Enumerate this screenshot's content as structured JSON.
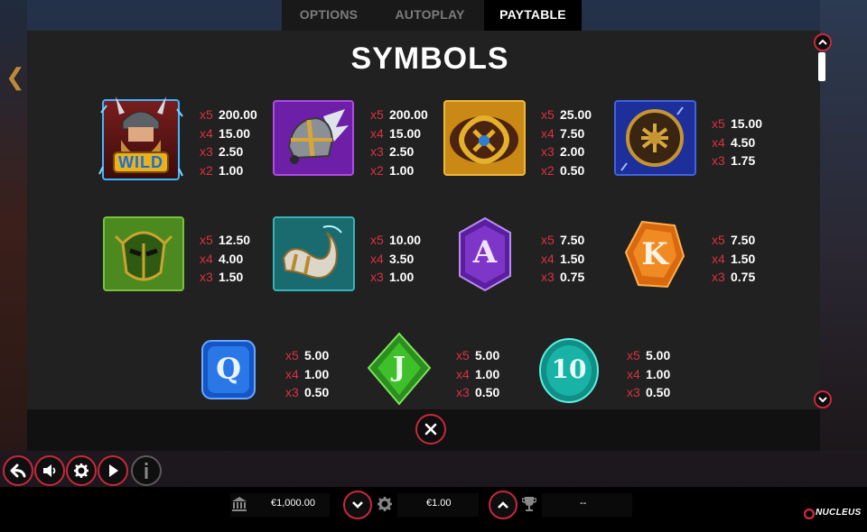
{
  "tabs": [
    {
      "label": "OPTIONS"
    },
    {
      "label": "AUTOPLAY"
    },
    {
      "label": "PAYTABLE"
    }
  ],
  "active_tab": "PAYTABLE",
  "title": "SYMBOLS",
  "symbols": [
    {
      "icon": "viking-wild-icon",
      "badge": "WILD",
      "pays": [
        {
          "mul": "x5",
          "val": "200.00"
        },
        {
          "mul": "x4",
          "val": "15.00"
        },
        {
          "mul": "x3",
          "val": "2.50"
        },
        {
          "mul": "x2",
          "val": "1.00"
        }
      ]
    },
    {
      "icon": "winged-helmet-icon",
      "pays": [
        {
          "mul": "x5",
          "val": "200.00"
        },
        {
          "mul": "x4",
          "val": "15.00"
        },
        {
          "mul": "x3",
          "val": "2.50"
        },
        {
          "mul": "x2",
          "val": "1.00"
        }
      ]
    },
    {
      "icon": "golden-knot-shield-icon",
      "pays": [
        {
          "mul": "x5",
          "val": "25.00"
        },
        {
          "mul": "x4",
          "val": "7.50"
        },
        {
          "mul": "x3",
          "val": "2.00"
        },
        {
          "mul": "x2",
          "val": "0.50"
        }
      ]
    },
    {
      "icon": "round-shield-icon",
      "pays": [
        {
          "mul": "x5",
          "val": "15.00"
        },
        {
          "mul": "x4",
          "val": "4.50"
        },
        {
          "mul": "x3",
          "val": "1.75"
        }
      ]
    },
    {
      "icon": "green-mask-icon",
      "pays": [
        {
          "mul": "x5",
          "val": "12.50"
        },
        {
          "mul": "x4",
          "val": "4.00"
        },
        {
          "mul": "x3",
          "val": "1.50"
        }
      ]
    },
    {
      "icon": "drinking-horn-icon",
      "pays": [
        {
          "mul": "x5",
          "val": "10.00"
        },
        {
          "mul": "x4",
          "val": "3.50"
        },
        {
          "mul": "x3",
          "val": "1.00"
        }
      ]
    },
    {
      "icon": "rune-a-icon",
      "glyph": "A",
      "pays": [
        {
          "mul": "x5",
          "val": "7.50"
        },
        {
          "mul": "x4",
          "val": "1.50"
        },
        {
          "mul": "x3",
          "val": "0.75"
        }
      ]
    },
    {
      "icon": "rune-k-icon",
      "glyph": "K",
      "pays": [
        {
          "mul": "x5",
          "val": "7.50"
        },
        {
          "mul": "x4",
          "val": "1.50"
        },
        {
          "mul": "x3",
          "val": "0.75"
        }
      ]
    },
    {
      "icon": "rune-q-icon",
      "glyph": "Q",
      "pays": [
        {
          "mul": "x5",
          "val": "5.00"
        },
        {
          "mul": "x4",
          "val": "1.00"
        },
        {
          "mul": "x3",
          "val": "0.50"
        }
      ]
    },
    {
      "icon": "rune-j-icon",
      "glyph": "J",
      "pays": [
        {
          "mul": "x5",
          "val": "5.00"
        },
        {
          "mul": "x4",
          "val": "1.00"
        },
        {
          "mul": "x3",
          "val": "0.50"
        }
      ]
    },
    {
      "icon": "rune-10-icon",
      "glyph": "10",
      "pays": [
        {
          "mul": "x5",
          "val": "5.00"
        },
        {
          "mul": "x4",
          "val": "1.00"
        },
        {
          "mul": "x3",
          "val": "0.50"
        }
      ]
    }
  ],
  "hud": {
    "balance": "€1,000.00",
    "bet": "€1.00",
    "win": "--",
    "brand": "NUCLEUS"
  },
  "colors": {
    "accent": "#c8283c",
    "panel": "#212121",
    "multiplier": "#d8323f"
  }
}
